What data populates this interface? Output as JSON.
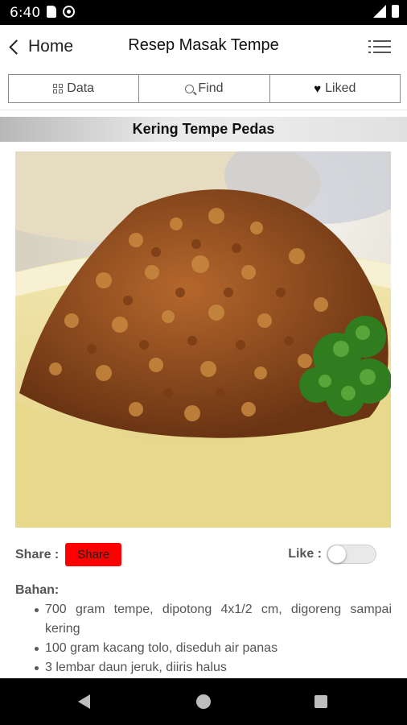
{
  "status_bar": {
    "time": "6:40",
    "icons": [
      "sim-card-icon",
      "sync-icon",
      "signal-icon",
      "battery-icon"
    ]
  },
  "app_bar": {
    "back_label": "Home",
    "title": "Resep Masak Tempe",
    "menu_icon": "hamburger-menu-icon"
  },
  "tabs": [
    {
      "label": "Data",
      "icon": "grid-icon"
    },
    {
      "label": "Find",
      "icon": "search-icon"
    },
    {
      "label": "Liked",
      "icon": "heart-icon"
    }
  ],
  "recipe": {
    "title": "Kering Tempe Pedas",
    "share_label": "Share :",
    "share_button": "Share",
    "like_label": "Like :",
    "liked": false,
    "ingredients_heading": "Bahan:",
    "ingredients": [
      "700 gram tempe, dipotong 4x1/2 cm, digoreng sampai kering",
      "100 gram kacang tolo, diseduh air panas",
      "3 lembar daun jeruk, diiris halus"
    ]
  },
  "colors": {
    "share_button": "#ff0000",
    "status_bar": "#000000",
    "nav_bar": "#000000"
  },
  "nav_bar": {
    "icons": [
      "back-triangle-icon",
      "home-circle-icon",
      "recents-square-icon"
    ]
  }
}
